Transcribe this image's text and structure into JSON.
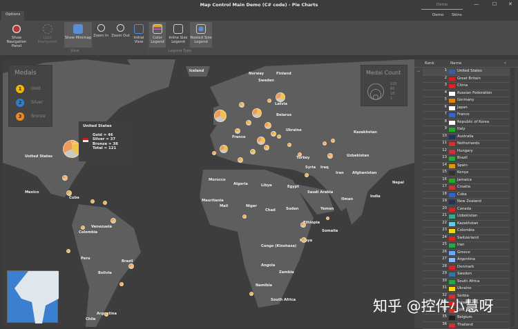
{
  "window": {
    "title": "Map Control Main Demo (C# code) - Pie Charts",
    "minimize": "—",
    "maximize": "☐",
    "close": "✕"
  },
  "top_right": {
    "group": "Demo",
    "tabs": [
      "Demo",
      "Skins"
    ]
  },
  "ribbon": {
    "tab": "Options",
    "buttons": [
      {
        "label": "Show Navigation Panel",
        "icon": "compass-icon"
      },
      {
        "label": "Lock Navigation",
        "icon": "lock-navigation-icon",
        "disabled": true
      },
      {
        "label": "Show Minimap",
        "icon": "minimap-icon",
        "selected": true
      },
      {
        "label": "Zoom In",
        "icon": "zoom-in-icon"
      },
      {
        "label": "Zoom Out",
        "icon": "zoom-out-icon"
      },
      {
        "label": "Initial View",
        "icon": "initial-view-icon"
      },
      {
        "label": "Color Legend",
        "icon": "color-legend-icon",
        "selected": true
      },
      {
        "label": "Inline Size Legend",
        "icon": "inline-size-legend-icon"
      },
      {
        "label": "Nested Size Legend",
        "icon": "nested-size-legend-icon",
        "selected": true
      }
    ],
    "groups": {
      "view": "View",
      "legend": "Legend Type"
    }
  },
  "legend": {
    "title": "Medals",
    "items": [
      {
        "label": "Gold",
        "num": "1",
        "color": "#f5b800"
      },
      {
        "label": "Silver",
        "num": "2",
        "color": "#2d7fd6"
      },
      {
        "label": "Bronze",
        "num": "3",
        "color": "#f08a1c"
      }
    ]
  },
  "size_legend": {
    "title": "Medal Count",
    "values": [
      "120",
      "60",
      "10",
      "1"
    ]
  },
  "tooltip": {
    "country": "United States",
    "gold": "Gold = 46",
    "silver": "Silver = 37",
    "bronze": "Bronze = 38",
    "total": "Total = 121"
  },
  "map_labels": [
    "Iceland",
    "Norway",
    "Finland",
    "Sweden",
    "Latvia",
    "Belarus",
    "Ukraine",
    "France",
    "Kazakhstan",
    "Uzbekistan",
    "Turkey",
    "Syria",
    "Iraq",
    "Iran",
    "Afghanistan",
    "Nepal",
    "India",
    "Morocco",
    "Algeria",
    "Libya",
    "Egypt",
    "Saudi Arabia",
    "Oman",
    "Yemen",
    "Mauritania",
    "Mali",
    "Niger",
    "Chad",
    "Sudan",
    "Ethiopia",
    "Somalia",
    "Kenya",
    "Congo (Kinshasa)",
    "Angola",
    "Zambia",
    "Namibia",
    "South Africa",
    "Mexico",
    "Cuba",
    "Venezuela",
    "Colombia",
    "Peru",
    "Brazil",
    "Bolivia",
    "Argentina",
    "Chile",
    "United States"
  ],
  "grid": {
    "headers": {
      "rank": "Rank",
      "name": "Name"
    },
    "rows": [
      [
        "1",
        "United States"
      ],
      [
        "2",
        "Great Britain"
      ],
      [
        "3",
        "China"
      ],
      [
        "4",
        "Russian Federation"
      ],
      [
        "5",
        "Germany"
      ],
      [
        "6",
        "Japan"
      ],
      [
        "7",
        "France"
      ],
      [
        "8",
        "Republic of Korea"
      ],
      [
        "9",
        "Italy"
      ],
      [
        "10",
        "Australia"
      ],
      [
        "11",
        "Netherlands"
      ],
      [
        "12",
        "Hungary"
      ],
      [
        "13",
        "Brazil"
      ],
      [
        "14",
        "Spain"
      ],
      [
        "15",
        "Kenya"
      ],
      [
        "16",
        "Jamaica"
      ],
      [
        "17",
        "Croatia"
      ],
      [
        "18",
        "Cuba"
      ],
      [
        "19",
        "New Zealand"
      ],
      [
        "20",
        "Canada"
      ],
      [
        "21",
        "Uzbekistan"
      ],
      [
        "22",
        "Kazakhstan"
      ],
      [
        "23",
        "Colombia"
      ],
      [
        "24",
        "Switzerland"
      ],
      [
        "25",
        "Iran"
      ],
      [
        "26",
        "Greece"
      ],
      [
        "27",
        "Argentina"
      ],
      [
        "28",
        "Denmark"
      ],
      [
        "29",
        "Sweden"
      ],
      [
        "30",
        "South Africa"
      ],
      [
        "31",
        "Ukraine"
      ],
      [
        "32",
        "Serbia"
      ],
      [
        "33",
        "Poland"
      ],
      [
        "34",
        "DPR Korea"
      ],
      [
        "35",
        "Belgium"
      ],
      [
        "36",
        "Thailand"
      ]
    ]
  },
  "watermark": "知乎 @控件小慧呀"
}
